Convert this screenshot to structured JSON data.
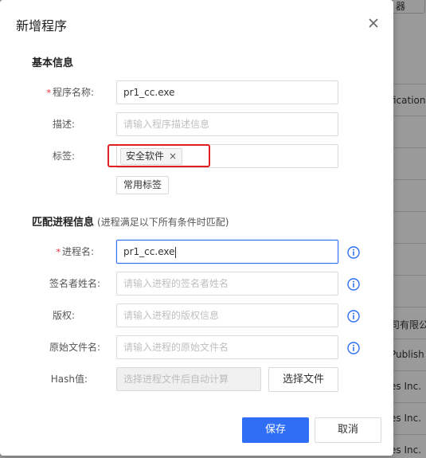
{
  "background": {
    "top_button": "器",
    "row_texts": [
      "fication",
      "公司有限公",
      "Publish",
      "es Inc.",
      "es Inc.",
      "es Inc."
    ]
  },
  "dialog": {
    "title": "新增程序",
    "sections": {
      "basic": {
        "title": "基本信息"
      },
      "match": {
        "title": "匹配进程信息",
        "subtitle": "(进程满足以下所有条件时匹配)"
      }
    },
    "fields": {
      "program_name": {
        "label": "程序名称:",
        "required": true,
        "value": "pr1_cc.exe"
      },
      "description": {
        "label": "描述:",
        "placeholder": "请输入程序描述信息"
      },
      "tags": {
        "label": "标签:",
        "items": [
          "安全软件"
        ],
        "close_glyph": "×"
      },
      "process_name": {
        "label": "进程名:",
        "required": true,
        "value": "pr1_cc.exe"
      },
      "signer_name": {
        "label": "签名者姓名:",
        "placeholder": "请输入进程的签名者姓名"
      },
      "copyright": {
        "label": "版权:",
        "placeholder": "请输入进程的版权信息"
      },
      "original_filename": {
        "label": "原始文件名:",
        "placeholder": "请输入进程的原始文件名"
      },
      "hash": {
        "label": "Hash值:",
        "placeholder": "选择进程文件后自动计算"
      }
    },
    "buttons": {
      "common_tags": "常用标签",
      "choose_file": "选择文件",
      "save": "保存",
      "cancel": "取消"
    },
    "required_mark": "*",
    "colors": {
      "primary": "#2f6ef5",
      "info": "#2f6ef5",
      "highlight": "#e02020"
    }
  }
}
